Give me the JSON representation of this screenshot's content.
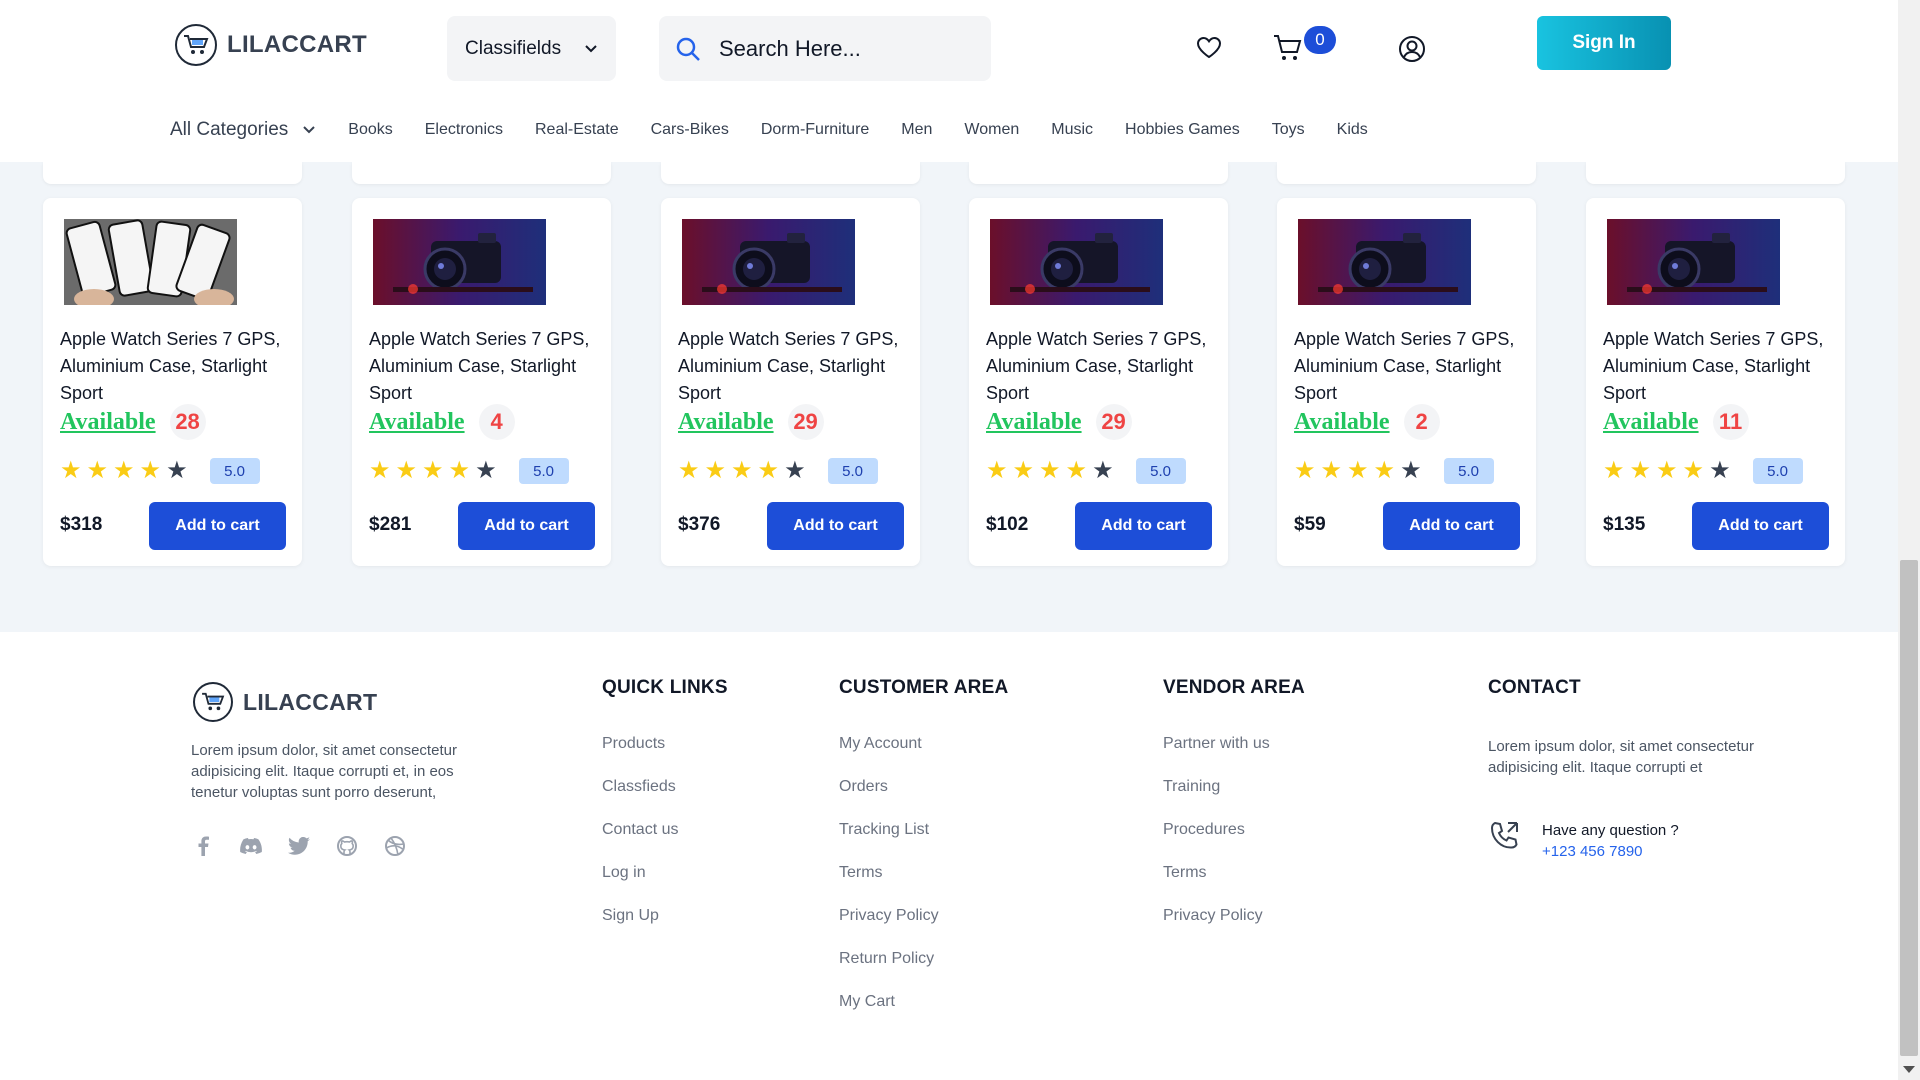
{
  "header": {
    "logo_text": "LILACCART",
    "classifield_selected": "Classifields",
    "search_placeholder": "Search Here...",
    "cart_count": "0",
    "signin_label": "Sign In",
    "all_categories_label": "All Categories",
    "categories": [
      "Books",
      "Electronics",
      "Real-Estate",
      "Cars-Bikes",
      "Dorm-Furniture",
      "Men",
      "Women",
      "Music",
      "Hobbies Games",
      "Toys",
      "Kids"
    ]
  },
  "products": [
    {
      "title": "Apple Watch Series 7 GPS, Aluminium Case, Starlight Sport",
      "availability": "Available",
      "stock": "28",
      "rating": "5.0",
      "stars": 4,
      "price": "$318",
      "button": "Add to cart",
      "image": "phones"
    },
    {
      "title": "Apple Watch Series 7 GPS, Aluminium Case, Starlight Sport",
      "availability": "Available",
      "stock": "4",
      "rating": "5.0",
      "stars": 4,
      "price": "$281",
      "button": "Add to cart",
      "image": "camera"
    },
    {
      "title": "Apple Watch Series 7 GPS, Aluminium Case, Starlight Sport",
      "availability": "Available",
      "stock": "29",
      "rating": "5.0",
      "stars": 4,
      "price": "$376",
      "button": "Add to cart",
      "image": "camera"
    },
    {
      "title": "Apple Watch Series 7 GPS, Aluminium Case, Starlight Sport",
      "availability": "Available",
      "stock": "29",
      "rating": "5.0",
      "stars": 4,
      "price": "$102",
      "button": "Add to cart",
      "image": "camera"
    },
    {
      "title": "Apple Watch Series 7 GPS, Aluminium Case, Starlight Sport",
      "availability": "Available",
      "stock": "2",
      "rating": "5.0",
      "stars": 4,
      "price": "$59",
      "button": "Add to cart",
      "image": "camera"
    },
    {
      "title": "Apple Watch Series 7 GPS, Aluminium Case, Starlight Sport",
      "availability": "Available",
      "stock": "11",
      "rating": "5.0",
      "stars": 4,
      "price": "$135",
      "button": "Add to cart",
      "image": "camera"
    }
  ],
  "footer": {
    "logo_text": "LILACCART",
    "description": "Lorem ipsum dolor, sit amet consectetur adipisicing elit. Itaque corrupti et, in eos tenetur voluptas sunt porro deserunt,",
    "quick_links": {
      "heading": "QUICK LINKS",
      "links": [
        "Products",
        "Classfieds",
        "Contact us",
        "Log in",
        "Sign Up"
      ]
    },
    "customer_area": {
      "heading": "CUSTOMER AREA",
      "links": [
        "My Account",
        "Orders",
        "Tracking List",
        "Terms",
        "Privacy Policy",
        "Return Policy",
        "My Cart"
      ]
    },
    "vendor_area": {
      "heading": "VENDOR AREA",
      "links": [
        "Partner with us",
        "Training",
        "Procedures",
        "Terms",
        "Privacy Policy"
      ]
    },
    "contact": {
      "heading": "CONTACT",
      "description": "Lorem ipsum dolor, sit amet consectetur adipisicing elit. Itaque corrupti et",
      "question_label": "Have any question ?",
      "phone": "+123 456 7890"
    }
  },
  "colors": {
    "primary_button": "#1d4ed8",
    "available": "#22c55e",
    "stock": "#ef4444",
    "star": "#facc15",
    "signin_gradient_start": "#19c3e0",
    "signin_gradient_end": "#0891b2"
  }
}
